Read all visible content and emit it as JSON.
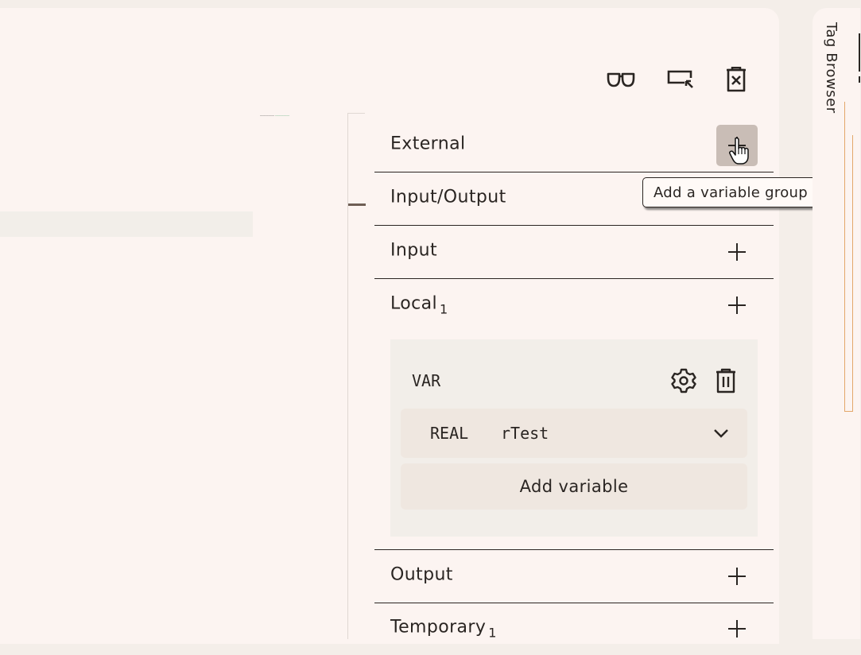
{
  "toolbar": {
    "view_icon": "glasses-icon",
    "select_icon": "select-cursor-icon",
    "delete_icon": "clear-icon"
  },
  "groups": [
    {
      "label": "External",
      "count": ""
    },
    {
      "label": "Input/Output",
      "count": ""
    },
    {
      "label": "Input",
      "count": ""
    },
    {
      "label": "Local",
      "count": "1"
    },
    {
      "label": "Output",
      "count": ""
    },
    {
      "label": "Temporary",
      "count": "1"
    }
  ],
  "var_section": {
    "label": "VAR",
    "variable": {
      "type": "REAL",
      "name": "rTest"
    },
    "add_variable_label": "Add variable"
  },
  "tooltip": "Add a variable group",
  "side_tab": {
    "label": "Tag Browser"
  },
  "colors": {
    "panel": "#fcf4f1",
    "background": "#f4eee9",
    "accent": "#e3a76a",
    "hover": "#c9bdb6"
  }
}
